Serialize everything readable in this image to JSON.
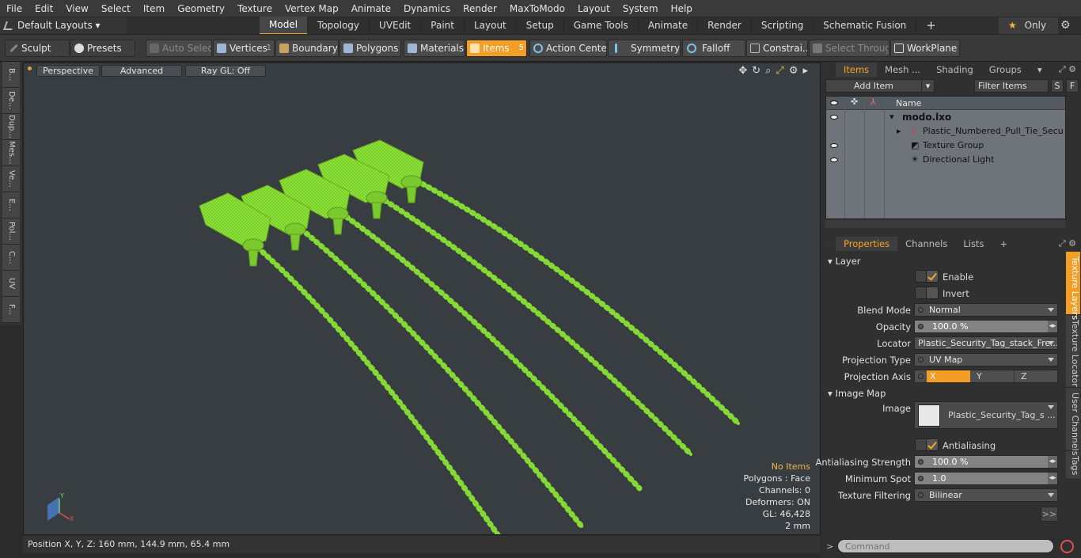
{
  "menu": [
    "File",
    "Edit",
    "View",
    "Select",
    "Item",
    "Geometry",
    "Texture",
    "Vertex Map",
    "Animate",
    "Dynamics",
    "Render",
    "MaxToModo",
    "Layout",
    "System",
    "Help"
  ],
  "layouts_label": "Default Layouts",
  "workspace_tabs": [
    "Model",
    "Topology",
    "UVEdit",
    "Paint",
    "Layout",
    "Setup",
    "Game Tools",
    "Animate",
    "Render",
    "Scripting",
    "Schematic Fusion"
  ],
  "only_label": "Only",
  "toolbar": {
    "sculpt": "Sculpt",
    "presets": "Presets",
    "auto_select": "Auto Select",
    "vertices": "Vertices",
    "vertices_count": "1",
    "boundary": "Boundary",
    "polygons": "Polygons",
    "materials": "Materials",
    "items": "Items",
    "items_count": "5",
    "action_center": "Action Center",
    "symmetry": "Symmetry",
    "falloff": "Falloff",
    "constraints": "Constrai...",
    "select_through": "Select Through",
    "workplane": "WorkPlane"
  },
  "left_tabs": [
    "B...",
    "De...",
    "Dup...",
    "Mes...",
    "Ve...",
    "E...",
    "Pol...",
    "C...",
    "UV",
    "F..."
  ],
  "viewport": {
    "perspective": "Perspective",
    "advanced": "Advanced",
    "raygl": "Ray GL: Off",
    "stats": {
      "no_items": "No Items",
      "polygons": "Polygons : Face",
      "channels": "Channels: 0",
      "deformers": "Deformers: ON",
      "gl": "GL: 46,428",
      "scale": "2 mm"
    },
    "axis_y": "Y",
    "axis_x": "X"
  },
  "status_position": "Position X, Y, Z:   160 mm, 144.9 mm, 65.4 mm",
  "items_panel": {
    "tabs": [
      "Items",
      "Mesh ...",
      "Shading",
      "Groups"
    ],
    "add_item": "Add Item",
    "filter_items": "Filter Items",
    "s_btn": "S",
    "f_btn": "F",
    "name_header": "Name",
    "tree": [
      "modo.lxo",
      "Plastic_Numbered_Pull_Tie_Securi...",
      "Texture Group",
      "Directional Light"
    ]
  },
  "props_panel": {
    "tabs": [
      "Properties",
      "Channels",
      "Lists"
    ],
    "layer_section": "Layer",
    "enable": "Enable",
    "invert": "Invert",
    "blend_mode_label": "Blend Mode",
    "blend_mode": "Normal",
    "opacity_label": "Opacity",
    "opacity": "100.0 %",
    "locator_label": "Locator",
    "locator": "Plastic_Security_Tag_stack_Fre...",
    "projection_type_label": "Projection Type",
    "projection_type": "UV Map",
    "projection_axis_label": "Projection Axis",
    "axis_x": "X",
    "axis_y": "Y",
    "axis_z": "Z",
    "image_map_section": "Image Map",
    "image_label": "Image",
    "image": "Plastic_Security_Tag_s ...",
    "antialiasing": "Antialiasing",
    "aa_strength_label": "Antialiasing Strength",
    "aa_strength": "100.0 %",
    "min_spot_label": "Minimum Spot",
    "min_spot": "1.0",
    "tex_filter_label": "Texture Filtering",
    "tex_filter": "Bilinear",
    "more": ">>",
    "side_tabs": [
      "Texture Layers",
      "Texture Locator",
      "User Channels",
      "Tags"
    ]
  },
  "command_placeholder": "Command",
  "colors": {
    "accent": "#f29e27",
    "model": "#8ee63a"
  }
}
